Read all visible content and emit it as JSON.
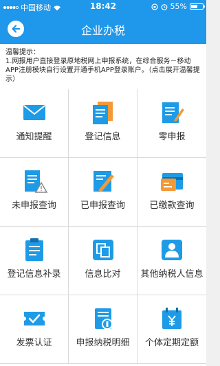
{
  "status_bar": {
    "carrier": "中国移动",
    "time": "18:42",
    "battery": "55%",
    "battery_level": 0.55,
    "icons": [
      "signal-icon",
      "wifi-icon",
      "rotation-lock-icon",
      "alarm-icon",
      "battery-icon"
    ]
  },
  "nav": {
    "title": "企业办税",
    "back_icon": "arrow-left-icon"
  },
  "notice": {
    "title": "温馨提示：",
    "body": "1.网报用户直接登录原地税网上申报系统，在综合服务－移动APP注册模块自行设置开通手机APP登录账户。（点击展开温馨提示）"
  },
  "tiles": [
    {
      "label": "通知提醒",
      "icon": "envelope-icon"
    },
    {
      "label": "登记信息",
      "icon": "documents-icon"
    },
    {
      "label": "零申报",
      "icon": "edit-document-icon"
    },
    {
      "label": "未申报查询",
      "icon": "warning-document-icon"
    },
    {
      "label": "已申报查询",
      "icon": "pencil-document-icon"
    },
    {
      "label": "已缴款查询",
      "icon": "payment-card-icon"
    },
    {
      "label": "登记信息补录",
      "icon": "clipboard-icon"
    },
    {
      "label": "信息比对",
      "icon": "compare-icon"
    },
    {
      "label": "其他纳税人信息",
      "icon": "person-card-icon"
    },
    {
      "label": "发票认证",
      "icon": "ticket-check-icon"
    },
    {
      "label": "申报纳税明细",
      "icon": "tax-detail-icon"
    },
    {
      "label": "个体定期定额",
      "icon": "calendar-yen-icon"
    }
  ],
  "colors": {
    "primary": "#1f97ea",
    "icon_blue": "#1e9be6",
    "accent_orange": "#f29a38"
  }
}
